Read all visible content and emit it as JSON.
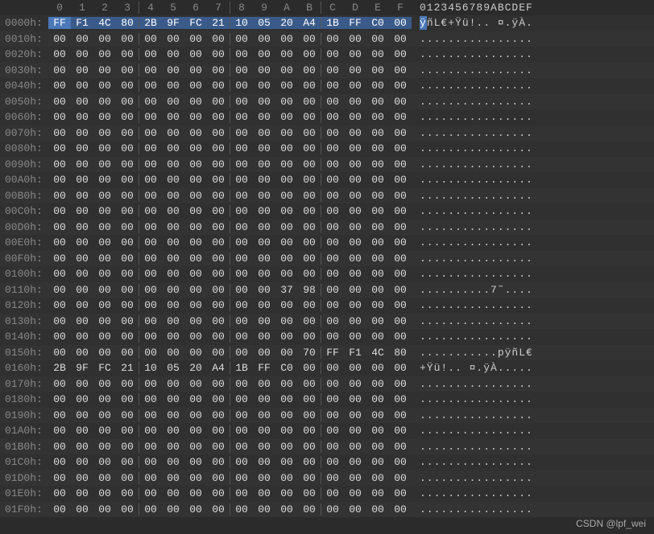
{
  "header": {
    "hex_cols": [
      "0",
      "1",
      "2",
      "3",
      "4",
      "5",
      "6",
      "7",
      "8",
      "9",
      "A",
      "B",
      "C",
      "D",
      "E",
      "F"
    ],
    "ascii_header": "0123456789ABCDEF"
  },
  "selection": {
    "row": 0,
    "col": 0
  },
  "watermark": "CSDN @lpf_wei",
  "rows": [
    {
      "offset": "0000h:",
      "hex": [
        "FF",
        "F1",
        "4C",
        "80",
        "2B",
        "9F",
        "FC",
        "21",
        "10",
        "05",
        "20",
        "A4",
        "1B",
        "FF",
        "C0",
        "00"
      ],
      "ascii": "ÿñL€+Ÿü!.. ¤.ÿÀ."
    },
    {
      "offset": "0010h:",
      "hex": [
        "00",
        "00",
        "00",
        "00",
        "00",
        "00",
        "00",
        "00",
        "00",
        "00",
        "00",
        "00",
        "00",
        "00",
        "00",
        "00"
      ],
      "ascii": "................"
    },
    {
      "offset": "0020h:",
      "hex": [
        "00",
        "00",
        "00",
        "00",
        "00",
        "00",
        "00",
        "00",
        "00",
        "00",
        "00",
        "00",
        "00",
        "00",
        "00",
        "00"
      ],
      "ascii": "................"
    },
    {
      "offset": "0030h:",
      "hex": [
        "00",
        "00",
        "00",
        "00",
        "00",
        "00",
        "00",
        "00",
        "00",
        "00",
        "00",
        "00",
        "00",
        "00",
        "00",
        "00"
      ],
      "ascii": "................"
    },
    {
      "offset": "0040h:",
      "hex": [
        "00",
        "00",
        "00",
        "00",
        "00",
        "00",
        "00",
        "00",
        "00",
        "00",
        "00",
        "00",
        "00",
        "00",
        "00",
        "00"
      ],
      "ascii": "................"
    },
    {
      "offset": "0050h:",
      "hex": [
        "00",
        "00",
        "00",
        "00",
        "00",
        "00",
        "00",
        "00",
        "00",
        "00",
        "00",
        "00",
        "00",
        "00",
        "00",
        "00"
      ],
      "ascii": "................"
    },
    {
      "offset": "0060h:",
      "hex": [
        "00",
        "00",
        "00",
        "00",
        "00",
        "00",
        "00",
        "00",
        "00",
        "00",
        "00",
        "00",
        "00",
        "00",
        "00",
        "00"
      ],
      "ascii": "................"
    },
    {
      "offset": "0070h:",
      "hex": [
        "00",
        "00",
        "00",
        "00",
        "00",
        "00",
        "00",
        "00",
        "00",
        "00",
        "00",
        "00",
        "00",
        "00",
        "00",
        "00"
      ],
      "ascii": "................"
    },
    {
      "offset": "0080h:",
      "hex": [
        "00",
        "00",
        "00",
        "00",
        "00",
        "00",
        "00",
        "00",
        "00",
        "00",
        "00",
        "00",
        "00",
        "00",
        "00",
        "00"
      ],
      "ascii": "................"
    },
    {
      "offset": "0090h:",
      "hex": [
        "00",
        "00",
        "00",
        "00",
        "00",
        "00",
        "00",
        "00",
        "00",
        "00",
        "00",
        "00",
        "00",
        "00",
        "00",
        "00"
      ],
      "ascii": "................"
    },
    {
      "offset": "00A0h:",
      "hex": [
        "00",
        "00",
        "00",
        "00",
        "00",
        "00",
        "00",
        "00",
        "00",
        "00",
        "00",
        "00",
        "00",
        "00",
        "00",
        "00"
      ],
      "ascii": "................"
    },
    {
      "offset": "00B0h:",
      "hex": [
        "00",
        "00",
        "00",
        "00",
        "00",
        "00",
        "00",
        "00",
        "00",
        "00",
        "00",
        "00",
        "00",
        "00",
        "00",
        "00"
      ],
      "ascii": "................"
    },
    {
      "offset": "00C0h:",
      "hex": [
        "00",
        "00",
        "00",
        "00",
        "00",
        "00",
        "00",
        "00",
        "00",
        "00",
        "00",
        "00",
        "00",
        "00",
        "00",
        "00"
      ],
      "ascii": "................"
    },
    {
      "offset": "00D0h:",
      "hex": [
        "00",
        "00",
        "00",
        "00",
        "00",
        "00",
        "00",
        "00",
        "00",
        "00",
        "00",
        "00",
        "00",
        "00",
        "00",
        "00"
      ],
      "ascii": "................"
    },
    {
      "offset": "00E0h:",
      "hex": [
        "00",
        "00",
        "00",
        "00",
        "00",
        "00",
        "00",
        "00",
        "00",
        "00",
        "00",
        "00",
        "00",
        "00",
        "00",
        "00"
      ],
      "ascii": "................"
    },
    {
      "offset": "00F0h:",
      "hex": [
        "00",
        "00",
        "00",
        "00",
        "00",
        "00",
        "00",
        "00",
        "00",
        "00",
        "00",
        "00",
        "00",
        "00",
        "00",
        "00"
      ],
      "ascii": "................"
    },
    {
      "offset": "0100h:",
      "hex": [
        "00",
        "00",
        "00",
        "00",
        "00",
        "00",
        "00",
        "00",
        "00",
        "00",
        "00",
        "00",
        "00",
        "00",
        "00",
        "00"
      ],
      "ascii": "................"
    },
    {
      "offset": "0110h:",
      "hex": [
        "00",
        "00",
        "00",
        "00",
        "00",
        "00",
        "00",
        "00",
        "00",
        "00",
        "37",
        "98",
        "00",
        "00",
        "00",
        "00"
      ],
      "ascii": "..........7˜...."
    },
    {
      "offset": "0120h:",
      "hex": [
        "00",
        "00",
        "00",
        "00",
        "00",
        "00",
        "00",
        "00",
        "00",
        "00",
        "00",
        "00",
        "00",
        "00",
        "00",
        "00"
      ],
      "ascii": "................"
    },
    {
      "offset": "0130h:",
      "hex": [
        "00",
        "00",
        "00",
        "00",
        "00",
        "00",
        "00",
        "00",
        "00",
        "00",
        "00",
        "00",
        "00",
        "00",
        "00",
        "00"
      ],
      "ascii": "................"
    },
    {
      "offset": "0140h:",
      "hex": [
        "00",
        "00",
        "00",
        "00",
        "00",
        "00",
        "00",
        "00",
        "00",
        "00",
        "00",
        "00",
        "00",
        "00",
        "00",
        "00"
      ],
      "ascii": "................"
    },
    {
      "offset": "0150h:",
      "hex": [
        "00",
        "00",
        "00",
        "00",
        "00",
        "00",
        "00",
        "00",
        "00",
        "00",
        "00",
        "70",
        "FF",
        "F1",
        "4C",
        "80"
      ],
      "ascii": "...........pÿñL€"
    },
    {
      "offset": "0160h:",
      "hex": [
        "2B",
        "9F",
        "FC",
        "21",
        "10",
        "05",
        "20",
        "A4",
        "1B",
        "FF",
        "C0",
        "00",
        "00",
        "00",
        "00",
        "00"
      ],
      "ascii": "+Ÿü!.. ¤.ÿÀ....."
    },
    {
      "offset": "0170h:",
      "hex": [
        "00",
        "00",
        "00",
        "00",
        "00",
        "00",
        "00",
        "00",
        "00",
        "00",
        "00",
        "00",
        "00",
        "00",
        "00",
        "00"
      ],
      "ascii": "................"
    },
    {
      "offset": "0180h:",
      "hex": [
        "00",
        "00",
        "00",
        "00",
        "00",
        "00",
        "00",
        "00",
        "00",
        "00",
        "00",
        "00",
        "00",
        "00",
        "00",
        "00"
      ],
      "ascii": "................"
    },
    {
      "offset": "0190h:",
      "hex": [
        "00",
        "00",
        "00",
        "00",
        "00",
        "00",
        "00",
        "00",
        "00",
        "00",
        "00",
        "00",
        "00",
        "00",
        "00",
        "00"
      ],
      "ascii": "................"
    },
    {
      "offset": "01A0h:",
      "hex": [
        "00",
        "00",
        "00",
        "00",
        "00",
        "00",
        "00",
        "00",
        "00",
        "00",
        "00",
        "00",
        "00",
        "00",
        "00",
        "00"
      ],
      "ascii": "................"
    },
    {
      "offset": "01B0h:",
      "hex": [
        "00",
        "00",
        "00",
        "00",
        "00",
        "00",
        "00",
        "00",
        "00",
        "00",
        "00",
        "00",
        "00",
        "00",
        "00",
        "00"
      ],
      "ascii": "................"
    },
    {
      "offset": "01C0h:",
      "hex": [
        "00",
        "00",
        "00",
        "00",
        "00",
        "00",
        "00",
        "00",
        "00",
        "00",
        "00",
        "00",
        "00",
        "00",
        "00",
        "00"
      ],
      "ascii": "................"
    },
    {
      "offset": "01D0h:",
      "hex": [
        "00",
        "00",
        "00",
        "00",
        "00",
        "00",
        "00",
        "00",
        "00",
        "00",
        "00",
        "00",
        "00",
        "00",
        "00",
        "00"
      ],
      "ascii": "................"
    },
    {
      "offset": "01E0h:",
      "hex": [
        "00",
        "00",
        "00",
        "00",
        "00",
        "00",
        "00",
        "00",
        "00",
        "00",
        "00",
        "00",
        "00",
        "00",
        "00",
        "00"
      ],
      "ascii": "................"
    },
    {
      "offset": "01F0h:",
      "hex": [
        "00",
        "00",
        "00",
        "00",
        "00",
        "00",
        "00",
        "00",
        "00",
        "00",
        "00",
        "00",
        "00",
        "00",
        "00",
        "00"
      ],
      "ascii": "................"
    }
  ]
}
